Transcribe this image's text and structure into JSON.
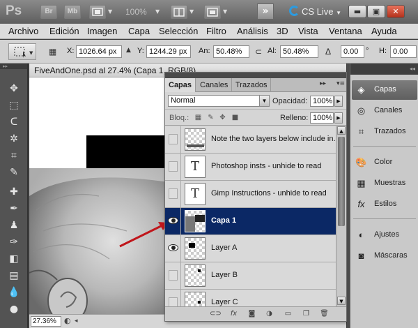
{
  "appbar": {
    "logo": "Ps",
    "bridge": "Br",
    "minibridge": "Mb",
    "zoom": "100%",
    "cs_live": "CS Live"
  },
  "menu": [
    "Archivo",
    "Edición",
    "Imagen",
    "Capa",
    "Selección",
    "Filtro",
    "Análisis",
    "3D",
    "Vista",
    "Ventana",
    "Ayuda"
  ],
  "options": {
    "x_label": "X:",
    "x_value": "1026.64 px",
    "y_label": "Y:",
    "y_value": "1244.29 px",
    "w_label": "An:",
    "w_value": "50.48%",
    "h_label": "Al:",
    "h_value": "50.48%",
    "angle_value": "0.00",
    "angle_unit": "°",
    "hskew_label": "H:",
    "hskew_value": "0.00"
  },
  "document": {
    "title": "FiveAndOne.psd al 27.4% (Capa 1, RGB/8)",
    "zoom": "27.36%"
  },
  "layers_panel": {
    "tabs": [
      "Capas",
      "Canales",
      "Trazados"
    ],
    "blend_mode": "Normal",
    "opacity_label": "Opacidad:",
    "opacity_value": "100%",
    "lock_label": "Bloq.:",
    "fill_label": "Relleno:",
    "fill_value": "100%",
    "layers": [
      {
        "name": "Note the two layers below include in...",
        "visible": false,
        "thumb": "note"
      },
      {
        "name": "Photoshop insts - unhide to read",
        "visible": false,
        "thumb": "text",
        "glyph": "T"
      },
      {
        "name": "Gimp Instructions - unhide to read",
        "visible": false,
        "thumb": "text",
        "glyph": "T"
      },
      {
        "name": "Capa 1",
        "visible": true,
        "thumb": "photo",
        "selected": true
      },
      {
        "name": "Layer A",
        "visible": true,
        "thumb": "small-black"
      },
      {
        "name": "Layer B",
        "visible": false,
        "thumb": "dot"
      },
      {
        "name": "Layer C",
        "visible": false,
        "thumb": "dot"
      }
    ]
  },
  "dock": [
    {
      "label": "Capas",
      "icon": "layers-icon",
      "active": true
    },
    {
      "label": "Canales",
      "icon": "channels-icon"
    },
    {
      "label": "Trazados",
      "icon": "paths-icon"
    },
    {
      "label": "Color",
      "icon": "palette-icon"
    },
    {
      "label": "Muestras",
      "icon": "swatches-icon"
    },
    {
      "label": "Estilos",
      "icon": "styles-icon"
    },
    {
      "label": "Ajustes",
      "icon": "adjustments-icon"
    },
    {
      "label": "Máscaras",
      "icon": "masks-icon"
    }
  ],
  "colors": {
    "selected_layer": "#0b2865",
    "annotation_arrow": "#c0161b",
    "cs_live_icon": "#2c9be0"
  }
}
